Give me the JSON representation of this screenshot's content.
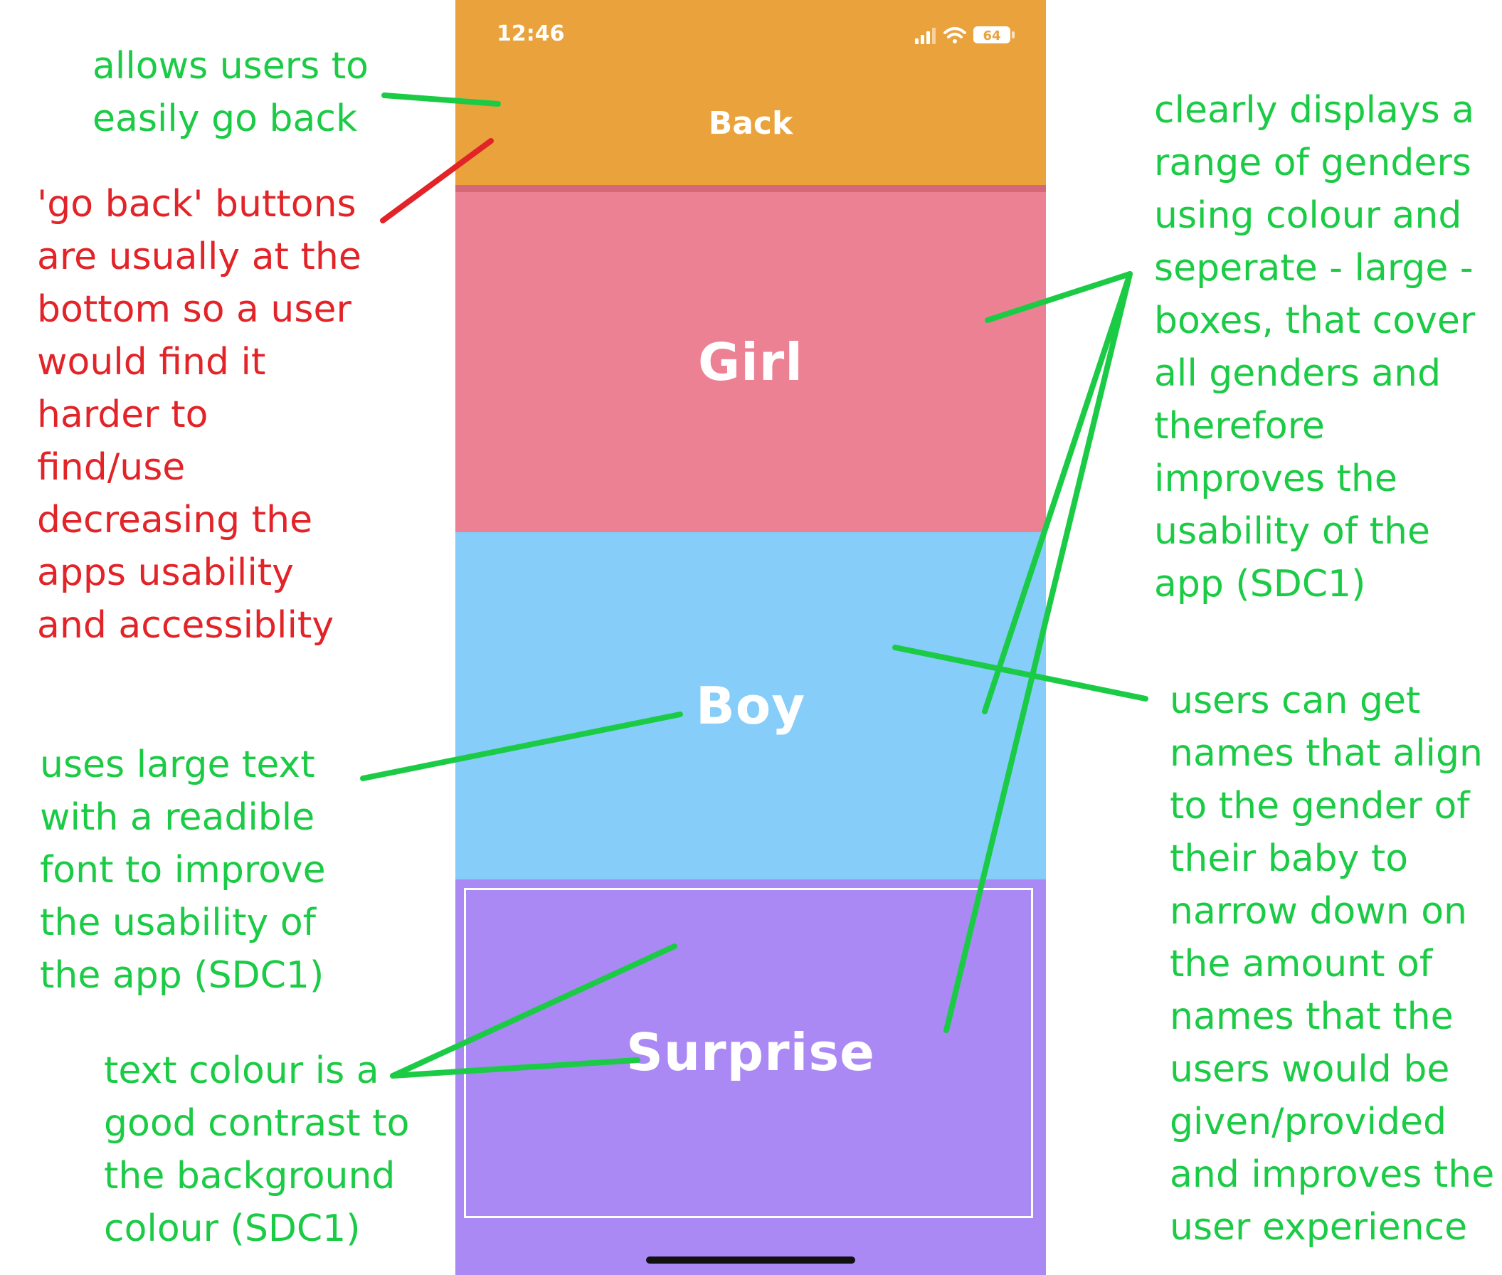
{
  "phone": {
    "status_time": "12:46",
    "battery_level": "64",
    "back_label": "Back",
    "tiles": {
      "girl": "Girl",
      "boy": "Boy",
      "surprise": "Surprise"
    },
    "colors": {
      "header": "#E9A23C",
      "girl": "#EC8194",
      "boy": "#86CDF9",
      "surprise": "#AA89F4"
    }
  },
  "annotations": {
    "back_note": [
      "allows users to",
      "easily go back"
    ],
    "back_critique": [
      "'go back' buttons",
      "are usually at the",
      "bottom so a user",
      "would find it",
      "harder to",
      "find/use",
      "decreasing the",
      "apps usability",
      "and accessiblity"
    ],
    "genders_note": [
      "clearly displays a",
      "range of genders",
      "using colour and",
      "seperate - large -",
      "boxes, that cover",
      "all genders and",
      "therefore",
      "improves the",
      "usability of the",
      "app (SDC1)"
    ],
    "large_text_note": [
      "uses large text",
      "with a readible",
      "font to improve",
      "the usability of",
      "the app (SDC1)"
    ],
    "contrast_note": [
      "text colour is a",
      "good contrast to",
      "the background",
      "colour (SDC1)"
    ],
    "names_note": [
      "users can get",
      "names that align",
      "to the gender of",
      "their baby to",
      "narrow down on",
      "the amount of",
      "names that the",
      "users would be",
      "given/provided",
      "and improves the",
      "user experience"
    ],
    "colors": {
      "positive": "#1BCB45",
      "negative": "#E22328"
    }
  }
}
